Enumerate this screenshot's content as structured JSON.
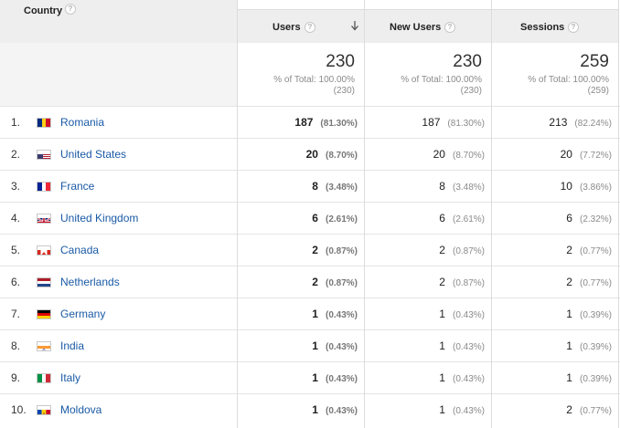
{
  "header": {
    "country_label": "Country",
    "users_label": "Users",
    "new_users_label": "New Users",
    "sessions_label": "Sessions",
    "help_glyph": "?"
  },
  "totals": {
    "users": {
      "value": "230",
      "pct_line": "% of Total: 100.00%",
      "abs_line": "(230)"
    },
    "new_users": {
      "value": "230",
      "pct_line": "% of Total: 100.00%",
      "abs_line": "(230)"
    },
    "sessions": {
      "value": "259",
      "pct_line": "% of Total: 100.00%",
      "abs_line": "(259)"
    }
  },
  "rows": [
    {
      "num": "1.",
      "country": "Romania",
      "flag": "romania-flag-icon",
      "users": "187",
      "users_pct": "(81.30%)",
      "new_users": "187",
      "new_users_pct": "(81.30%)",
      "sessions": "213",
      "sessions_pct": "(82.24%)"
    },
    {
      "num": "2.",
      "country": "United States",
      "flag": "usa-flag-icon",
      "users": "20",
      "users_pct": "(8.70%)",
      "new_users": "20",
      "new_users_pct": "(8.70%)",
      "sessions": "20",
      "sessions_pct": "(7.72%)"
    },
    {
      "num": "3.",
      "country": "France",
      "flag": "france-flag-icon",
      "users": "8",
      "users_pct": "(3.48%)",
      "new_users": "8",
      "new_users_pct": "(3.48%)",
      "sessions": "10",
      "sessions_pct": "(3.86%)"
    },
    {
      "num": "4.",
      "country": "United Kingdom",
      "flag": "uk-flag-icon",
      "users": "6",
      "users_pct": "(2.61%)",
      "new_users": "6",
      "new_users_pct": "(2.61%)",
      "sessions": "6",
      "sessions_pct": "(2.32%)"
    },
    {
      "num": "5.",
      "country": "Canada",
      "flag": "canada-flag-icon",
      "users": "2",
      "users_pct": "(0.87%)",
      "new_users": "2",
      "new_users_pct": "(0.87%)",
      "sessions": "2",
      "sessions_pct": "(0.77%)"
    },
    {
      "num": "6.",
      "country": "Netherlands",
      "flag": "netherlands-flag-icon",
      "users": "2",
      "users_pct": "(0.87%)",
      "new_users": "2",
      "new_users_pct": "(0.87%)",
      "sessions": "2",
      "sessions_pct": "(0.77%)"
    },
    {
      "num": "7.",
      "country": "Germany",
      "flag": "germany-flag-icon",
      "users": "1",
      "users_pct": "(0.43%)",
      "new_users": "1",
      "new_users_pct": "(0.43%)",
      "sessions": "1",
      "sessions_pct": "(0.39%)"
    },
    {
      "num": "8.",
      "country": "India",
      "flag": "india-flag-icon",
      "users": "1",
      "users_pct": "(0.43%)",
      "new_users": "1",
      "new_users_pct": "(0.43%)",
      "sessions": "1",
      "sessions_pct": "(0.39%)"
    },
    {
      "num": "9.",
      "country": "Italy",
      "flag": "italy-flag-icon",
      "users": "1",
      "users_pct": "(0.43%)",
      "new_users": "1",
      "new_users_pct": "(0.43%)",
      "sessions": "1",
      "sessions_pct": "(0.39%)"
    },
    {
      "num": "10.",
      "country": "Moldova",
      "flag": "moldova-flag-icon",
      "users": "1",
      "users_pct": "(0.43%)",
      "new_users": "1",
      "new_users_pct": "(0.43%)",
      "sessions": "2",
      "sessions_pct": "(0.77%)"
    }
  ],
  "colors": {
    "link": "#1a5aa6",
    "header_bg": "#eeeeee",
    "muted": "#8a8a8a"
  }
}
